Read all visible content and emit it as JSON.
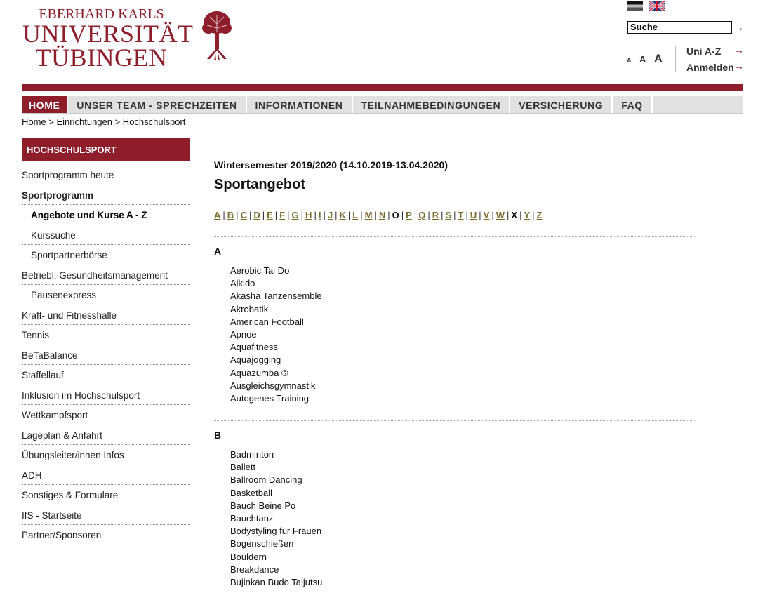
{
  "header": {
    "logo_line1": "EBERHARD KARLS",
    "logo_line2": "UNIVERSITÄT",
    "logo_line3": "TÜBINGEN",
    "search_label": "Suche",
    "font_sizes": [
      "A",
      "A",
      "A"
    ],
    "link_uni_az": "Uni A-Z",
    "link_login": "Anmelden",
    "arrow": "→"
  },
  "nav": {
    "items": [
      "HOME",
      "UNSER TEAM - SPRECHZEITEN",
      "INFORMATIONEN",
      "TEILNAHMEBEDINGUNGEN",
      "VERSICHERUNG",
      "FAQ"
    ]
  },
  "breadcrumb": "Home > Einrichtungen > Hochschulsport",
  "sidebar": {
    "heading": "HOCHSCHULSPORT",
    "items": [
      "Sportprogramm heute",
      "Sportprogramm",
      "Angebote und Kurse A - Z",
      "Kurssuche",
      "Sportpartnerbörse",
      "Betriebl. Gesundheitsmanagement",
      "Pausenexpress",
      "Kraft- und Fitnesshalle",
      "Tennis",
      "BeTaBalance",
      "Staffellauf",
      "Inklusion im Hochschulsport",
      "Wettkampfsport",
      "Lageplan & Anfahrt",
      "Übungsleiter/innen Infos",
      "ADH",
      "Sonstiges & Formulare",
      "IfS - Startseite",
      "Partner/Sponsoren"
    ]
  },
  "main": {
    "semester": "Wintersemester 2019/2020 (14.10.2019-13.04.2020)",
    "title": "Sportangebot",
    "alphabet": [
      "A",
      "B",
      "C",
      "D",
      "E",
      "F",
      "G",
      "H",
      "I",
      "J",
      "K",
      "L",
      "M",
      "N",
      "O",
      "P",
      "Q",
      "R",
      "S",
      "T",
      "U",
      "V",
      "W",
      "X",
      "Y",
      "Z"
    ],
    "sections": [
      {
        "letter": "A",
        "courses": [
          "Aerobic Tai Do",
          "Aikido",
          "Akasha Tanzensemble",
          "Akrobatik",
          "American Football",
          "Apnoe",
          "Aquafitness",
          "Aquajogging",
          "Aquazumba ®",
          "Ausgleichsgymnastik",
          "Autogenes Training"
        ]
      },
      {
        "letter": "B",
        "courses": [
          "Badminton",
          "Ballett",
          "Ballroom Dancing",
          "Basketball",
          "Bauch Beine Po",
          "Bauchtanz",
          "Bodystyling für Frauen",
          "Bogenschießen",
          "Bouldern",
          "Breakdance",
          "Bujinkan Budo Taijutsu"
        ]
      }
    ]
  }
}
